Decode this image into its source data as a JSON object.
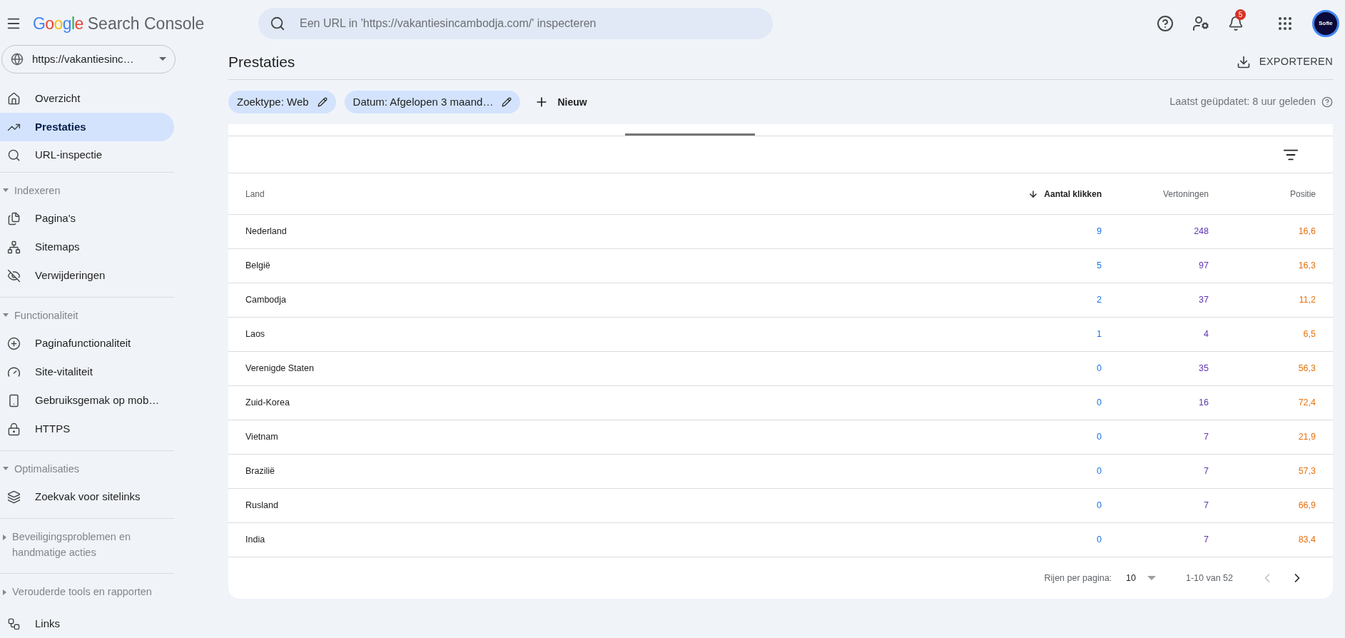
{
  "header": {
    "logo": "Google",
    "product": "Search Console",
    "search": {
      "placeholder": "Een URL in 'https://vakantiesincambodja.com/' inspecteren"
    },
    "notifications_badge": "5",
    "avatar": "Sofie"
  },
  "sidebar": {
    "property": "https://vakantiesinc…",
    "items": [
      {
        "kind": "item",
        "label": "Overzicht",
        "selected": false
      },
      {
        "kind": "item",
        "label": "Prestaties",
        "selected": true
      },
      {
        "kind": "item",
        "label": "URL-inspectie",
        "selected": false
      },
      {
        "kind": "section",
        "label": "Indexeren",
        "expanded": true,
        "children": [
          {
            "kind": "item",
            "label": "Pagina's",
            "selected": false
          },
          {
            "kind": "item",
            "label": "Sitemaps",
            "selected": false
          },
          {
            "kind": "item",
            "label": "Verwijderingen",
            "selected": false
          }
        ]
      },
      {
        "kind": "section",
        "label": "Functionaliteit",
        "expanded": true,
        "children": [
          {
            "kind": "item",
            "label": "Paginafunctionaliteit",
            "selected": false
          },
          {
            "kind": "item",
            "label": "Site-vitaliteit",
            "selected": false
          },
          {
            "kind": "item",
            "label": "Gebruiksgemak op mob…",
            "selected": false
          },
          {
            "kind": "item",
            "label": "HTTPS",
            "selected": false
          }
        ]
      },
      {
        "kind": "section",
        "label": "Optimalisaties",
        "expanded": true,
        "children": [
          {
            "kind": "item",
            "label": "Zoekvak voor sitelinks",
            "selected": false
          }
        ]
      },
      {
        "kind": "section",
        "label": "Beveiligingsproblemen en handmatige acties",
        "expanded": false
      },
      {
        "kind": "section",
        "label": "Verouderde tools en rapporten",
        "expanded": false
      },
      {
        "kind": "item",
        "label": "Links",
        "selected": false
      }
    ]
  },
  "page": {
    "title": "Prestaties",
    "export": "EXPORTEREN",
    "filters": [
      "Zoektype: Web",
      "Datum: Afgelopen 3 maand…"
    ],
    "new_filter": "Nieuw",
    "updated": "Laatst geüpdatet: 8 uur geleden"
  },
  "table": {
    "columns": [
      {
        "label": "Land",
        "sorted": false
      },
      {
        "label": "Aantal klikken",
        "sorted": true,
        "color": "#1a73e8"
      },
      {
        "label": "Vertoningen",
        "sorted": false,
        "color": "#5e35b1"
      },
      {
        "label": "Positie",
        "sorted": false,
        "color": "#e8710a"
      }
    ],
    "rows": [
      [
        "Nederland",
        "9",
        "248",
        "16,6"
      ],
      [
        "België",
        "5",
        "97",
        "16,3"
      ],
      [
        "Cambodja",
        "2",
        "37",
        "11,2"
      ],
      [
        "Laos",
        "1",
        "4",
        "6,5"
      ],
      [
        "Verenigde Staten",
        "0",
        "35",
        "56,3"
      ],
      [
        "Zuid-Korea",
        "0",
        "16",
        "72,4"
      ],
      [
        "Vietnam",
        "0",
        "7",
        "21,9"
      ],
      [
        "Brazilië",
        "0",
        "7",
        "57,3"
      ],
      [
        "Rusland",
        "0",
        "7",
        "66,9"
      ],
      [
        "India",
        "0",
        "7",
        "83,4"
      ]
    ],
    "pagination": {
      "rows_label": "Rijen per pagina:",
      "rows_value": "10",
      "range": "1-10 van 52"
    }
  }
}
